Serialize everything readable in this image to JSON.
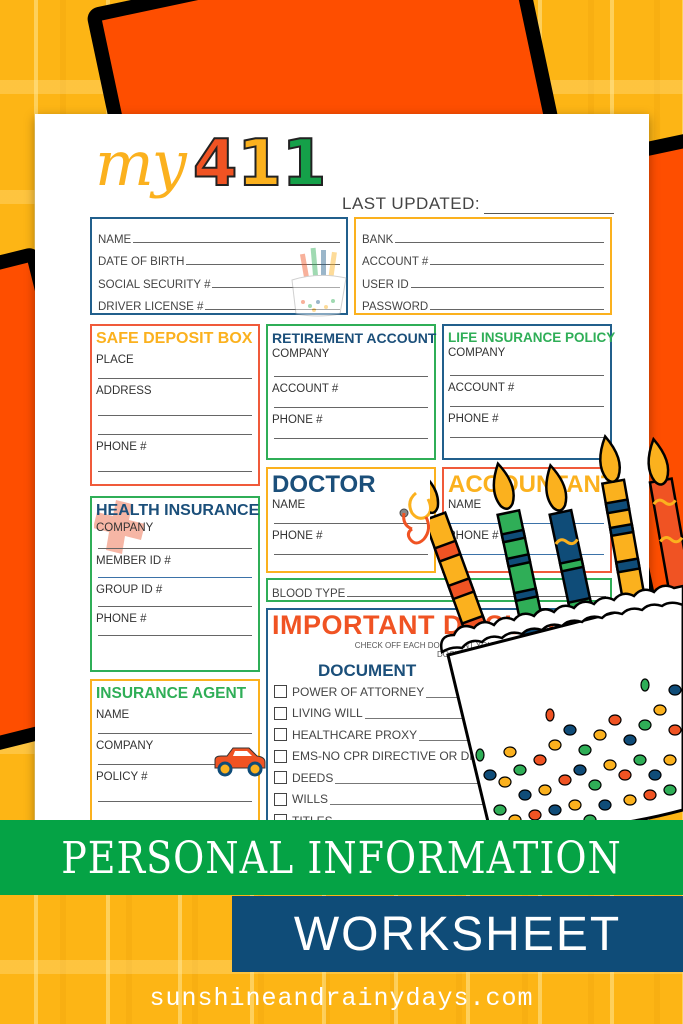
{
  "brand": {
    "my": "my",
    "digits": [
      "4",
      "1",
      "1"
    ],
    "colors": {
      "four": "#f05323",
      "one_a": "#fbb11e",
      "one_b": "#15a049"
    }
  },
  "last_updated_label": "LAST UPDATED:",
  "personal": {
    "fields": [
      "NAME",
      "DATE OF BIRTH",
      "SOCIAL SECURITY #",
      "DRIVER LICENSE #"
    ]
  },
  "bank": {
    "fields": [
      "BANK",
      "ACCOUNT #",
      "USER ID",
      "PASSWORD"
    ]
  },
  "safe_deposit": {
    "title": "SAFE DEPOSIT BOX",
    "fields": [
      "PLACE",
      "ADDRESS",
      "PHONE #"
    ]
  },
  "retirement": {
    "title": "RETIREMENT ACCOUNT",
    "fields": [
      "COMPANY",
      "ACCOUNT #",
      "PHONE #"
    ]
  },
  "life_insurance": {
    "title": "LIFE INSURANCE POLICY",
    "fields": [
      "COMPANY",
      "ACCOUNT #",
      "PHONE #"
    ]
  },
  "health_insurance": {
    "title": "HEALTH INSURANCE",
    "fields": [
      "COMPANY",
      "MEMBER ID #",
      "GROUP ID #",
      "PHONE #"
    ]
  },
  "doctor": {
    "title": "DOCTOR",
    "fields": [
      "NAME",
      "PHONE #"
    ]
  },
  "accountant": {
    "title": "ACCOUNTANT",
    "fields": [
      "NAME",
      "PHONE #"
    ]
  },
  "blood_type_label": "BLOOD TYPE",
  "insurance_agent": {
    "title": "INSURANCE AGENT",
    "fields": [
      "NAME",
      "COMPANY",
      "POLICY #"
    ]
  },
  "important_docs": {
    "title": "IMPORTANT DOCUMENTS",
    "subtitle_line1": "CHECK OFF EACH DOCUMENT YOU",
    "subtitle_line2": "DOCUMENT C",
    "column_header": "DOCUMENT",
    "items": [
      "POWER OF ATTORNEY",
      "LIVING WILL",
      "HEALTHCARE PROXY",
      "EMS-NO CPR DIRECTIVE OR DNR",
      "DEEDS",
      "WILLS",
      "TITLES"
    ]
  },
  "banner": {
    "line1": "PERSONAL INFORMATION",
    "line2": "WORKSHEET",
    "url": "sunshineandrainydays.com",
    "green": "#05a345",
    "blue": "#0f4c78"
  }
}
